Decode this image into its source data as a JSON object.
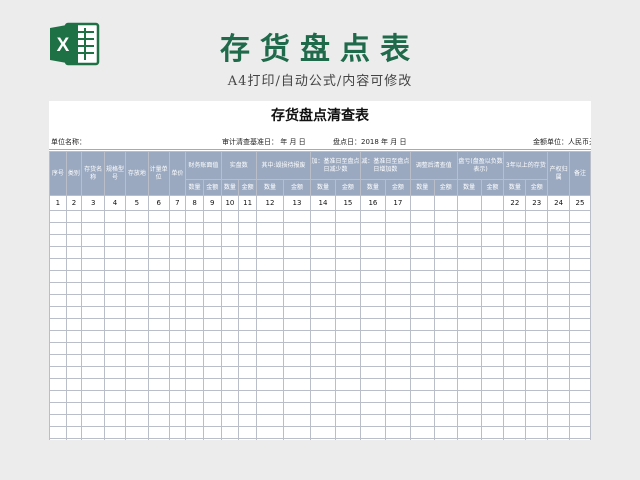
{
  "header": {
    "title": "存货盘点表",
    "subtitle": "A4打印/自动公式/内容可修改",
    "logo_letter": "X",
    "accent": "#1f6a4a",
    "logo_color": "#1e7145"
  },
  "sheet": {
    "title": "存货盘点清查表",
    "info": {
      "unit": "单位名称：",
      "audit_date": "审计清查基准日：   年  月   日",
      "count_date": "盘点日：2018 年  月  日",
      "amount_unit": "金额单位：人民币元"
    },
    "headers": {
      "seq": "序号",
      "category": "类别",
      "name": "存货名称",
      "spec": "规格型号",
      "location": "存放地",
      "unit": "计量单位",
      "price": "单价",
      "book": "财务账面值",
      "actual": "实盘数",
      "between": "其中:毁损待报废",
      "add_decrease": "加：基准日至盘点日减少数",
      "sub_increase": "减：基准日至盘点日增加数",
      "adjusted": "调整后清查值",
      "surplus": "盘亏(盘盈以负数表示)",
      "over3y": "3年以上的存货",
      "owner": "产权归属",
      "note": "备注",
      "qty": "数量",
      "amount": "金额"
    },
    "col_numbers": [
      "1",
      "2",
      "3",
      "4",
      "5",
      "6",
      "7",
      "8",
      "9",
      "10",
      "11",
      "12",
      "13",
      "14",
      "15",
      "16",
      "17",
      "",
      "",
      "",
      "",
      "22",
      "23",
      "24",
      "25"
    ]
  }
}
